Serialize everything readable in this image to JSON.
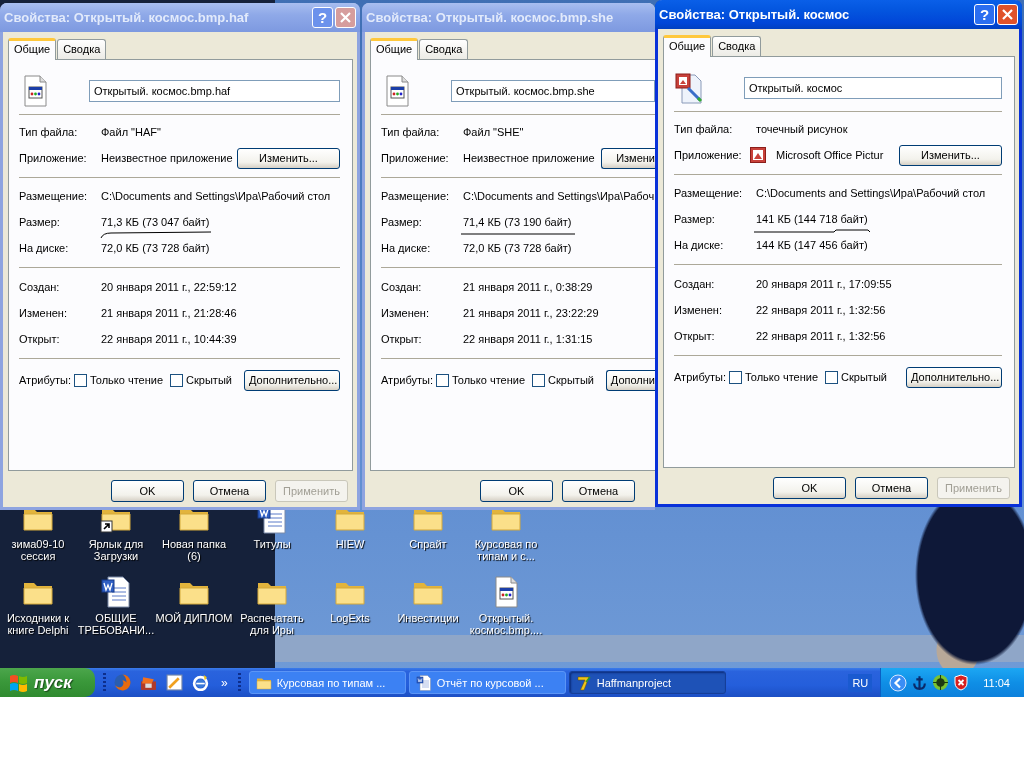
{
  "windows": [
    {
      "title": "Свойства: Открытый. космос.bmp.haf",
      "active": false,
      "title_buttons": true,
      "help_button": "?",
      "tabs": [
        {
          "label": "Общие",
          "selected": true
        },
        {
          "label": "Сводка",
          "selected": false
        }
      ],
      "file": {
        "kind": "unknown",
        "name": "Открытый. космос.bmp.haf"
      },
      "type": {
        "label": "Тип файла:",
        "value": "Файл \"HAF\""
      },
      "application": {
        "label": "Приложение:",
        "value": "Неизвестное приложение",
        "icon": false,
        "button": "Изменить..."
      },
      "location": {
        "label": "Размещение:",
        "value": "C:\\Documents and Settings\\Ира\\Рабочий стол"
      },
      "size": {
        "label": "Размер:",
        "value": "71,3 КБ (73 047 байт)",
        "underlined": true
      },
      "on_disk": {
        "label": "На диске:",
        "value": "72,0 КБ (73 728 байт)"
      },
      "created": {
        "label": "Создан:",
        "value": "20 января 2011 г., 22:59:12"
      },
      "modified": {
        "label": "Изменен:",
        "value": "21 января 2011 г., 21:28:46"
      },
      "opened": {
        "label": "Открыт:",
        "value": "22 января 2011 г., 10:44:39"
      },
      "attributes": {
        "label": "Атрибуты:",
        "checkboxes": [
          {
            "label": "Только чтение",
            "checked": false
          },
          {
            "label": "Скрытый",
            "checked": false
          }
        ],
        "button": "Дополнительно..."
      },
      "buttons": [
        {
          "label": "OK",
          "disabled": false
        },
        {
          "label": "Отмена",
          "disabled": false
        },
        {
          "label": "Применить",
          "disabled": true
        }
      ]
    },
    {
      "title": "Свойства: Открытый. космос.bmp.she",
      "active": false,
      "title_buttons": false,
      "tabs": [
        {
          "label": "Общие",
          "selected": true
        },
        {
          "label": "Сводка",
          "selected": false
        }
      ],
      "file": {
        "kind": "unknown",
        "name": "Открытый. космос.bmp.she"
      },
      "type": {
        "label": "Тип файла:",
        "value": "Файл \"SHE\""
      },
      "application": {
        "label": "Приложение:",
        "value": "Неизвестное приложение",
        "icon": false,
        "button": "Измени"
      },
      "location": {
        "label": "Размещение:",
        "value": "C:\\Documents and Settings\\Ира\\Рабоч"
      },
      "size": {
        "label": "Размер:",
        "value": "71,4 КБ (73 190 байт)",
        "underlined": true
      },
      "on_disk": {
        "label": "На диске:",
        "value": "72,0 КБ (73 728 байт)"
      },
      "created": {
        "label": "Создан:",
        "value": "21 января 2011 г., 0:38:29"
      },
      "modified": {
        "label": "Изменен:",
        "value": "21 января 2011 г., 23:22:29"
      },
      "opened": {
        "label": "Открыт:",
        "value": "22 января 2011 г., 1:31:15"
      },
      "attributes": {
        "label": "Атрибуты:",
        "checkboxes": [
          {
            "label": "Только чтение",
            "checked": false
          },
          {
            "label": "Скрытый",
            "checked": false
          }
        ],
        "button": "Дополни"
      },
      "buttons": [
        {
          "label": "OK",
          "disabled": false
        },
        {
          "label": "Отмена",
          "disabled": false
        }
      ]
    },
    {
      "title": "Свойства: Открытый. космос",
      "active": true,
      "title_buttons": true,
      "help_button": "?",
      "tabs": [
        {
          "label": "Общие",
          "selected": true
        },
        {
          "label": "Сводка",
          "selected": false
        }
      ],
      "file": {
        "kind": "picture",
        "name": "Открытый. космос"
      },
      "type": {
        "label": "Тип файла:",
        "value": "точечный рисунок"
      },
      "application": {
        "label": "Приложение:",
        "value": "Microsoft Office Pictur",
        "icon": true,
        "button": "Изменить..."
      },
      "location": {
        "label": "Размещение:",
        "value": "C:\\Documents and Settings\\Ира\\Рабочий стол"
      },
      "size": {
        "label": "Размер:",
        "value": "141 КБ (144 718 байт)",
        "underlined": true
      },
      "on_disk": {
        "label": "На диске:",
        "value": "144 КБ (147 456 байт)"
      },
      "created": {
        "label": "Создан:",
        "value": "20 января 2011 г., 17:09:55"
      },
      "modified": {
        "label": "Изменен:",
        "value": "22 января 2011 г., 1:32:56"
      },
      "opened": {
        "label": "Открыт:",
        "value": "22 января 2011 г., 1:32:56"
      },
      "attributes": {
        "label": "Атрибуты:",
        "checkboxes": [
          {
            "label": "Только чтение",
            "checked": false
          },
          {
            "label": "Скрытый",
            "checked": false
          }
        ],
        "button": "Дополнительно..."
      },
      "buttons": [
        {
          "label": "OK",
          "disabled": false
        },
        {
          "label": "Отмена",
          "disabled": false
        },
        {
          "label": "Применить",
          "disabled": true
        }
      ]
    }
  ],
  "desktop_icons": [
    {
      "kind": "folder",
      "label": "зима09-10\nсессия"
    },
    {
      "kind": "shortcut",
      "label": "Ярлык для\nЗагрузки"
    },
    {
      "kind": "folder",
      "label": "Новая папка\n(6)"
    },
    {
      "kind": "word",
      "label": "Титулы"
    },
    {
      "kind": "folder",
      "label": "HIEW"
    },
    {
      "kind": "folder",
      "label": "Спрайт"
    },
    {
      "kind": "folder",
      "label": "Курсовая по\nтипам и с..."
    },
    {
      "kind": "folder",
      "label": "Исходники к\nкниге Delphi"
    },
    {
      "kind": "word",
      "label": "ОБЩИЕ\nТРЕБОВАНИ..."
    },
    {
      "kind": "folder",
      "label": "МОЙ ДИПЛОМ"
    },
    {
      "kind": "folder",
      "label": "Распечатать\nдля Иры"
    },
    {
      "kind": "folder",
      "label": "LogExts"
    },
    {
      "kind": "folder",
      "label": "Инвестиции"
    },
    {
      "kind": "file",
      "label": "Открытый.\nкосмос.bmp...."
    }
  ],
  "taskbar": {
    "start": "пуск",
    "quick_launch_more": "»",
    "tasks": [
      {
        "kind": "folder",
        "label": "Курсовая по типам ...",
        "selected": false
      },
      {
        "kind": "word",
        "label": "Отчёт по курсовой ...",
        "selected": false
      },
      {
        "kind": "delphi",
        "label": "Haffmanproject",
        "selected": true
      }
    ],
    "language": "RU",
    "clock": "11:04"
  }
}
